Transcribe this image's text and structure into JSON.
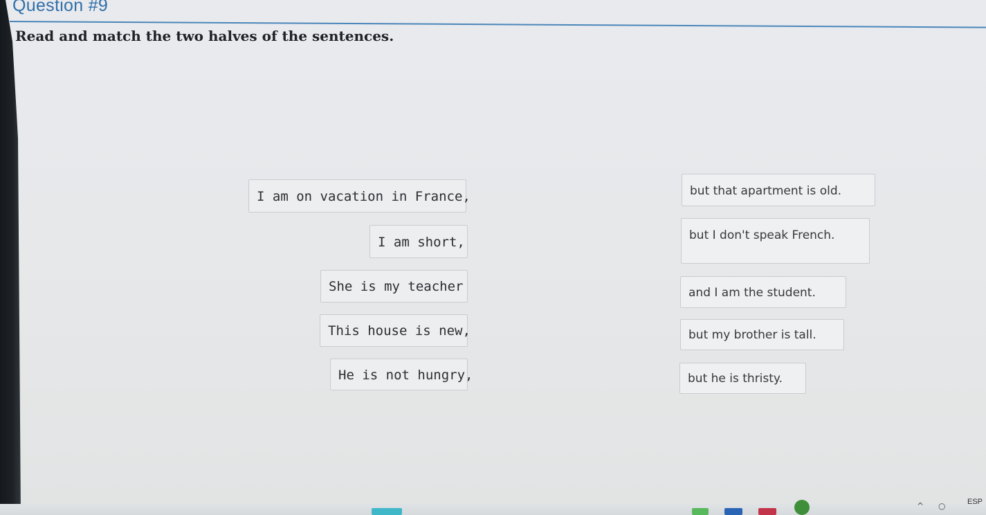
{
  "question": {
    "title": "Question #9",
    "instructions": "Read and match the two halves of the sentences."
  },
  "left_halves": [
    "I am on vacation in France,",
    "I am short,",
    "She is my teacher",
    "This house is new,",
    "He is not hungry,"
  ],
  "right_halves": [
    "but that apartment is old.",
    "but I don't speak French.",
    "and I am the student.",
    "but my brother is tall.",
    "but he is thristy."
  ],
  "taskbar": {
    "language": "ESP",
    "icons": [
      "teal-app-icon",
      "green-app-icon",
      "blue-app-icon",
      "red-app-icon",
      "chrome-icon"
    ],
    "accent_colors": [
      "#3fb7c9",
      "#57b85c",
      "#2a64b5",
      "#c2344a",
      "#3f8f3a"
    ]
  }
}
